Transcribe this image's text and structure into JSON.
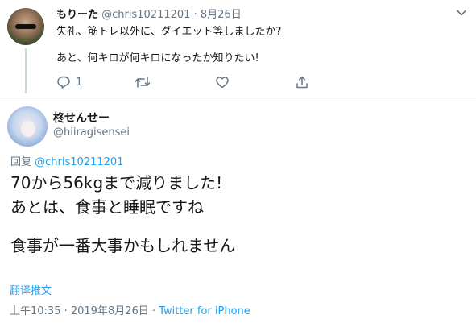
{
  "reply_tweet": {
    "author_name": "もりーた",
    "handle": "@chris10211201",
    "separator": "·",
    "date": "8月26日",
    "lines": [
      "失礼、筋トレ以外に、ダイエット等しましたか?",
      "あと、何キロが何キロになったか知りたい!"
    ],
    "reply_count": "1",
    "icons": [
      "more-chevron",
      "reply",
      "retweet",
      "like",
      "share"
    ]
  },
  "main_tweet": {
    "author_name": "柊せんせー",
    "handle": "@hiiragisensei",
    "reply_prefix": "回复",
    "reply_mention": "@chris10211201",
    "lines": [
      "70から56kgまで減りました!",
      "あとは、食事と睡眠ですね",
      "食事が一番大事かもしれません"
    ],
    "translate_label": "翻译推文",
    "timestamp": "上午10:35 · 2019年8月26日 ·",
    "source": "Twitter for iPhone"
  },
  "colors": {
    "accent": "#1da1f2",
    "secondary_text": "#657786",
    "divider": "#e6ecf0"
  }
}
